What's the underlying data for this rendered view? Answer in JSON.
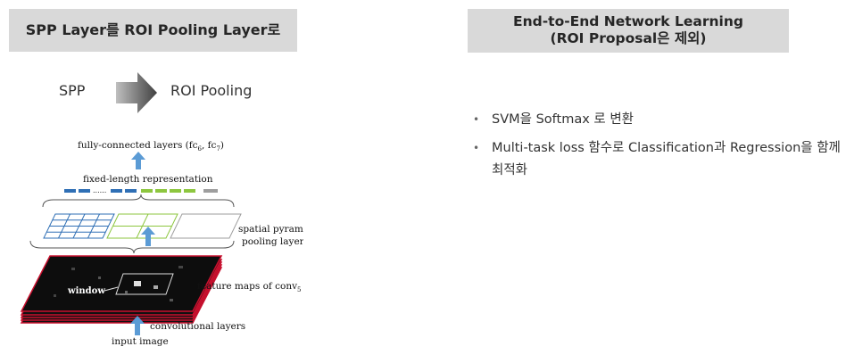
{
  "left_header": "SPP Layer를 ROI Pooling Layer로",
  "right_header": {
    "line1": "End-to-End Network Learning",
    "line2": "(ROI Proposal은 제외)"
  },
  "transition": {
    "from": "SPP",
    "to": "ROI Pooling"
  },
  "bullets": [
    "SVM을 Softmax 로 변환",
    "Multi-task loss 함수로 Classification과 Regression을 함께 최적화"
  ],
  "figure": {
    "fc_label": "fully-connected layers (fc",
    "fc_sub1": "6",
    "fc_mid": ", fc",
    "fc_sub2": "7",
    "fc_end": ")",
    "fixed_label": "fixed-length representation",
    "dots": "......",
    "spp_label_1": "spatial pyramid",
    "spp_label_2": "pooling layer",
    "window_label": "window",
    "feature_label": "feature maps of conv",
    "feature_sub": "5",
    "conv_label": "convolutional layers",
    "input_label": "input image",
    "colors": {
      "blue": "#2f6fb5",
      "green": "#8dc63f",
      "gray": "#9e9e9e",
      "arrow": "#5b9bd5",
      "stack_red": "#c8102e"
    }
  },
  "colors": {
    "header_bg": "#d9d9d9",
    "arrow_gray": "#595959"
  }
}
